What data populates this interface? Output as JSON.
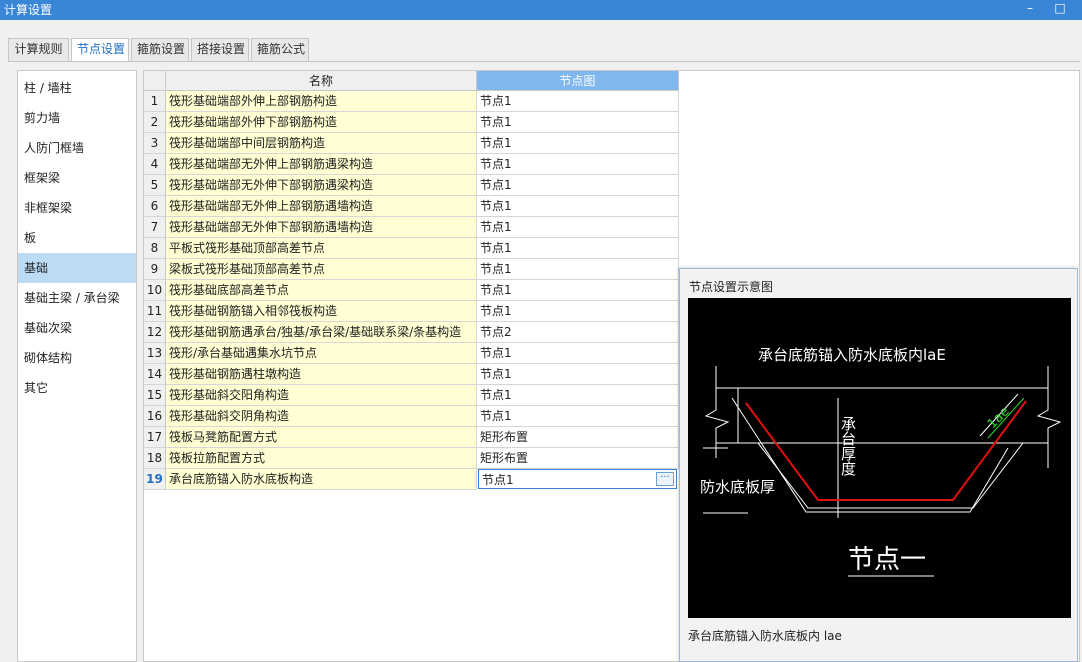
{
  "window": {
    "title": "计算设置",
    "minimize_glyph": "–",
    "maximize_glyph": "□"
  },
  "tabs": [
    {
      "label": "计算规则",
      "active": false
    },
    {
      "label": "节点设置",
      "active": true
    },
    {
      "label": "箍筋设置",
      "active": false
    },
    {
      "label": "搭接设置",
      "active": false
    },
    {
      "label": "箍筋公式",
      "active": false
    }
  ],
  "sidebar": {
    "items": [
      {
        "label": "柱 / 墙柱"
      },
      {
        "label": "剪力墙"
      },
      {
        "label": "人防门框墙"
      },
      {
        "label": "框架梁"
      },
      {
        "label": "非框架梁"
      },
      {
        "label": "板"
      },
      {
        "label": "基础",
        "selected": true
      },
      {
        "label": "基础主梁 / 承台梁"
      },
      {
        "label": "基础次梁"
      },
      {
        "label": "砌体结构"
      },
      {
        "label": "其它"
      }
    ]
  },
  "grid": {
    "columns": {
      "name": "名称",
      "diagram": "节点图"
    },
    "rows": [
      {
        "num": "1",
        "name": "筏形基础端部外伸上部钢筋构造",
        "value": "节点1"
      },
      {
        "num": "2",
        "name": "筏形基础端部外伸下部钢筋构造",
        "value": "节点1"
      },
      {
        "num": "3",
        "name": "筏形基础端部中间层钢筋构造",
        "value": "节点1"
      },
      {
        "num": "4",
        "name": "筏形基础端部无外伸上部钢筋遇梁构造",
        "value": "节点1"
      },
      {
        "num": "5",
        "name": "筏形基础端部无外伸下部钢筋遇梁构造",
        "value": "节点1"
      },
      {
        "num": "6",
        "name": "筏形基础端部无外伸上部钢筋遇墙构造",
        "value": "节点1"
      },
      {
        "num": "7",
        "name": "筏形基础端部无外伸下部钢筋遇墙构造",
        "value": "节点1"
      },
      {
        "num": "8",
        "name": "平板式筏形基础顶部高差节点",
        "value": "节点1"
      },
      {
        "num": "9",
        "name": "梁板式筏形基础顶部高差节点",
        "value": "节点1"
      },
      {
        "num": "10",
        "name": "筏形基础底部高差节点",
        "value": "节点1"
      },
      {
        "num": "11",
        "name": "筏形基础钢筋锚入相邻筏板构造",
        "value": "节点1"
      },
      {
        "num": "12",
        "name": "筏形基础钢筋遇承台/独基/承台梁/基础联系梁/条基构造",
        "value": "节点2"
      },
      {
        "num": "13",
        "name": "筏形/承台基础遇集水坑节点",
        "value": "节点1"
      },
      {
        "num": "14",
        "name": "筏形基础钢筋遇柱墩构造",
        "value": "节点1"
      },
      {
        "num": "15",
        "name": "筏形基础斜交阳角构造",
        "value": "节点1"
      },
      {
        "num": "16",
        "name": "筏形基础斜交阴角构造",
        "value": "节点1"
      },
      {
        "num": "17",
        "name": "筏板马凳筋配置方式",
        "value": "矩形布置"
      },
      {
        "num": "18",
        "name": "筏板拉筋配置方式",
        "value": "矩形布置"
      },
      {
        "num": "19",
        "name": "承台底筋锚入防水底板构造",
        "value": "节点1",
        "current": true
      }
    ],
    "ellipsis_glyph": "···"
  },
  "preview": {
    "title": "节点设置示意图",
    "caption": "承台底筋锚入防水底板内 lae",
    "diagram": {
      "heading": "承台底筋锚入防水底板内laE",
      "label_lae": "1ae",
      "label_thickness": "承台厚度",
      "label_slab": "防水底板厚",
      "node_title": "节点一",
      "line_color": "#ffffff",
      "rebar_color": "#e01010",
      "dim_color": "#33dd33"
    }
  }
}
